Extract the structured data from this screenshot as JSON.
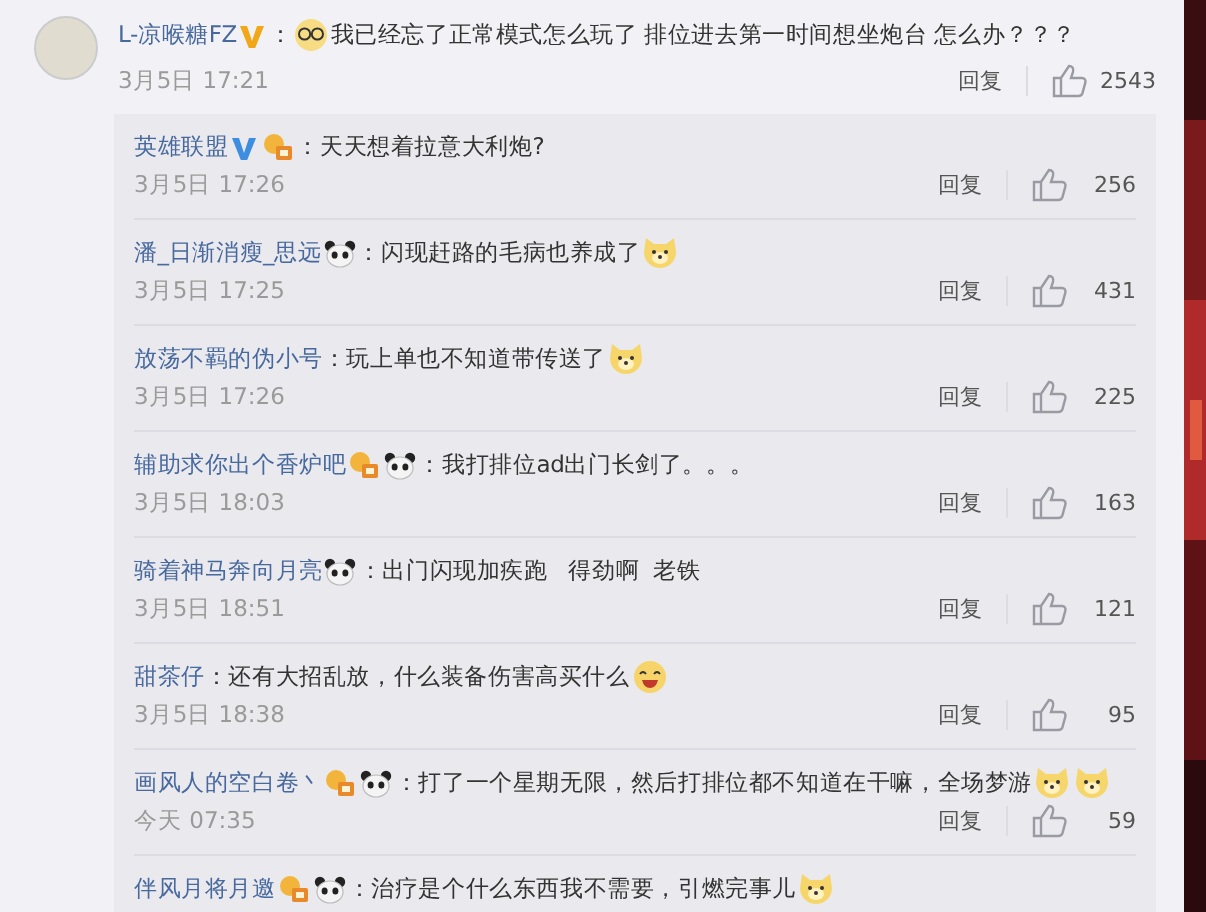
{
  "comment": {
    "name": "L-凉喉糖FZ",
    "badges": [
      {
        "kind": "orange_v"
      }
    ],
    "separator": "：",
    "lead_emoji": {
      "kind": "glasses"
    },
    "text": "我已经忘了正常模式怎么玩了 排位进去第一时间想坐炮台 怎么办？？？",
    "time": "3月5日 17:21",
    "reply_label": "回复",
    "likes": "2543"
  },
  "replies": [
    {
      "name": "英雄联盟",
      "badges": [
        {
          "kind": "blue_v"
        },
        {
          "kind": "crown"
        }
      ],
      "separator": "：",
      "text": "天天想着拉意大利炮?",
      "time": "3月5日 17:26",
      "reply_label": "回复",
      "likes": "256"
    },
    {
      "name": "潘_日渐消瘦_思远",
      "badges": [
        {
          "kind": "panda"
        }
      ],
      "separator": "：",
      "text": "闪现赶路的毛病也养成了",
      "trail_emojis": [
        {
          "kind": "dog"
        }
      ],
      "time": "3月5日 17:25",
      "reply_label": "回复",
      "likes": "431"
    },
    {
      "name": "放荡不羁的伪小号",
      "separator": "：",
      "text": "玩上单也不知道带传送了",
      "trail_emojis": [
        {
          "kind": "dog"
        }
      ],
      "time": "3月5日 17:26",
      "reply_label": "回复",
      "likes": "225"
    },
    {
      "name": "辅助求你出个香炉吧",
      "badges": [
        {
          "kind": "crown"
        },
        {
          "kind": "panda"
        }
      ],
      "separator": "：",
      "text": "我打排位ad出门长剑了。。。",
      "time": "3月5日 18:03",
      "reply_label": "回复",
      "likes": "163"
    },
    {
      "name": "骑着神马奔向月亮",
      "badges": [
        {
          "kind": "panda"
        }
      ],
      "separator": "：",
      "text": "出门闪现加疾跑   得劲啊  老铁",
      "time": "3月5日 18:51",
      "reply_label": "回复",
      "likes": "121"
    },
    {
      "name": "甜茶仔",
      "separator": "：",
      "text": "还有大招乱放，什么装备伤害高买什么",
      "trail_emojis": [
        {
          "kind": "laugh"
        }
      ],
      "time": "3月5日 18:38",
      "reply_label": "回复",
      "likes": "95"
    },
    {
      "name": "画风人的空白卷丶",
      "badges": [
        {
          "kind": "crown"
        },
        {
          "kind": "panda"
        }
      ],
      "separator": "：",
      "text": "打了一个星期无限，然后打排位都不知道在干嘛，全场梦游",
      "trail_emojis": [
        {
          "kind": "dog"
        },
        {
          "kind": "dog"
        }
      ],
      "time": "今天 07:35",
      "reply_label": "回复",
      "likes": "59"
    },
    {
      "name": "伴风月将月邀",
      "badges": [
        {
          "kind": "crown"
        },
        {
          "kind": "panda"
        }
      ],
      "separator": "：",
      "text": "治疗是个什么东西我不需要，引燃完事儿",
      "trail_emojis": [
        {
          "kind": "dog"
        }
      ]
    }
  ]
}
